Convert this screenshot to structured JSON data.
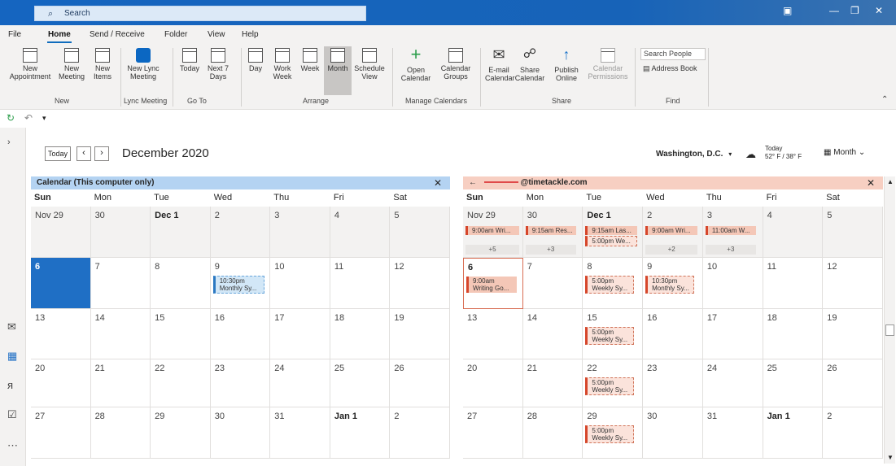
{
  "search": {
    "label": "Search"
  },
  "menu": {
    "tabs": [
      "File",
      "Home",
      "Send / Receive",
      "Folder",
      "View",
      "Help"
    ]
  },
  "ribbon": {
    "new_appointment": "New Appointment",
    "new_meeting": "New Meeting",
    "new_items": "New Items",
    "new_lync_meeting": "New Lync Meeting",
    "today": "Today",
    "next_7_days": "Next 7 Days",
    "day": "Day",
    "work_week": "Work Week",
    "week": "Week",
    "month": "Month",
    "schedule_view": "Schedule View",
    "open_calendar": "Open Calendar",
    "calendar_groups": "Calendar Groups",
    "email_calendar": "E-mail Calendar",
    "share_calendar": "Share Calendar",
    "publish_online": "Publish Online",
    "calendar_permissions": "Calendar Permissions",
    "search_people": "Search People",
    "address_book": "Address Book",
    "groups": {
      "new": "New",
      "lync": "Lync Meeting",
      "goto": "Go To",
      "arrange": "Arrange",
      "manage": "Manage Calendars",
      "share": "Share",
      "find": "Find"
    }
  },
  "header": {
    "today_btn": "Today",
    "month_title": "December 2020",
    "location": "Washington, D.C.",
    "weather_label": "Today",
    "weather_temp": "52° F / 38° F",
    "view": "Month"
  },
  "days": [
    "Sun",
    "Mon",
    "Tue",
    "Wed",
    "Thu",
    "Fri",
    "Sat"
  ],
  "left_calendar": {
    "title": "Calendar (This computer only)",
    "weeks": [
      [
        "Nov 29",
        "30",
        "Dec 1",
        "2",
        "3",
        "4",
        "5"
      ],
      [
        "6",
        "7",
        "8",
        "9",
        "10",
        "11",
        "12"
      ],
      [
        "13",
        "14",
        "15",
        "16",
        "17",
        "18",
        "19"
      ],
      [
        "20",
        "21",
        "22",
        "23",
        "24",
        "25",
        "26"
      ],
      [
        "27",
        "28",
        "29",
        "30",
        "31",
        "Jan 1",
        "2"
      ]
    ],
    "event_wed9": {
      "time": "10:30pm",
      "title": "Monthly Sy..."
    }
  },
  "right_calendar": {
    "title": "@timetackle.com",
    "weeks": [
      [
        "Nov 29",
        "30",
        "Dec 1",
        "2",
        "3",
        "4",
        "5"
      ],
      [
        "6",
        "7",
        "8",
        "9",
        "10",
        "11",
        "12"
      ],
      [
        "13",
        "14",
        "15",
        "16",
        "17",
        "18",
        "19"
      ],
      [
        "20",
        "21",
        "22",
        "23",
        "24",
        "25",
        "26"
      ],
      [
        "27",
        "28",
        "29",
        "30",
        "31",
        "Jan 1",
        "2"
      ]
    ],
    "events": {
      "sun29": "9:00am Wri...",
      "mon30": "9:15am Res...",
      "tue1a": "9:15am Las...",
      "tue1b": "5:00pm We...",
      "wed2": "9:00am Wri...",
      "thu3": "11:00am W...",
      "more_sun": "+5",
      "more_mon": "+3",
      "more_wed": "+2",
      "more_thu": "+3",
      "sun6_time": "9:00am",
      "sun6_title": "Writing Go...",
      "tue8_time": "5:00pm",
      "tue8_title": "Weekly Sy...",
      "wed9_time": "10:30pm",
      "wed9_title": "Monthly Sy...",
      "tue15_time": "5:00pm",
      "tue15_title": "Weekly Sy...",
      "tue22_time": "5:00pm",
      "tue22_title": "Weekly Sy...",
      "tue29_time": "5:00pm",
      "tue29_title": "Weekly Sy..."
    }
  },
  "colors": {
    "accent": "#0f6cbd",
    "left_header": "#b4d3f2",
    "right_header": "#f7cfc2",
    "event": "#d6462b"
  }
}
